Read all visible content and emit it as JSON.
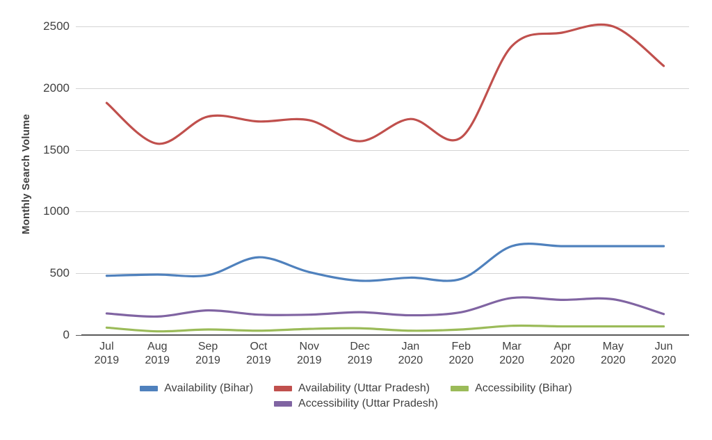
{
  "chart_data": {
    "type": "line",
    "title": "",
    "xlabel": "",
    "ylabel": "Monthly Search Volume",
    "ylim": [
      0,
      2500
    ],
    "yticks": [
      0,
      500,
      1000,
      1500,
      2000,
      2500
    ],
    "ytick_labels": [
      "0",
      "500",
      "1000",
      "1500",
      "2000",
      "2500"
    ],
    "grid": true,
    "legend_position": "bottom",
    "smooth": true,
    "categories": [
      "Jul\n2019",
      "Aug\n2019",
      "Sep\n2019",
      "Oct\n2019",
      "Nov\n2019",
      "Dec\n2019",
      "Jan\n2020",
      "Feb\n2020",
      "Mar\n2020",
      "Apr\n2020",
      "May\n2020",
      "Jun\n2020"
    ],
    "category_months": [
      "Jul",
      "Aug",
      "Sep",
      "Oct",
      "Nov",
      "Dec",
      "Jan",
      "Feb",
      "Mar",
      "Apr",
      "May",
      "Jun"
    ],
    "category_years": [
      "2019",
      "2019",
      "2019",
      "2019",
      "2019",
      "2019",
      "2020",
      "2020",
      "2020",
      "2020",
      "2020",
      "2020"
    ],
    "series": [
      {
        "name": "Availability (Bihar)",
        "color": "#4F81BD",
        "values": [
          480,
          490,
          485,
          630,
          510,
          440,
          465,
          455,
          720,
          720,
          720,
          720
        ]
      },
      {
        "name": "Availability (Uttar Pradesh)",
        "color": "#C0504D",
        "values": [
          1880,
          1550,
          1770,
          1730,
          1740,
          1570,
          1750,
          1600,
          2340,
          2450,
          2500,
          2180
        ]
      },
      {
        "name": "Accessibility (Bihar)",
        "color": "#9BBB59",
        "values": [
          60,
          30,
          45,
          35,
          50,
          55,
          35,
          45,
          75,
          70,
          70,
          70
        ]
      },
      {
        "name": "Accessibility (Uttar Pradesh)",
        "color": "#8064A2",
        "values": [
          175,
          150,
          200,
          165,
          165,
          185,
          160,
          185,
          300,
          285,
          290,
          170
        ]
      }
    ]
  },
  "legend": {
    "rows": [
      [
        "Availability (Bihar)",
        "Availability (Uttar Pradesh)",
        "Accessibility (Bihar)"
      ],
      [
        "Accessibility (Uttar Pradesh)"
      ]
    ]
  },
  "colors": {
    "series_blue": "#4F81BD",
    "series_red": "#C0504D",
    "series_green": "#9BBB59",
    "series_purple": "#8064A2",
    "gridline": "#D4D4D4",
    "axis": "#595959",
    "text": "#404040",
    "background": "#FFFFFF"
  }
}
